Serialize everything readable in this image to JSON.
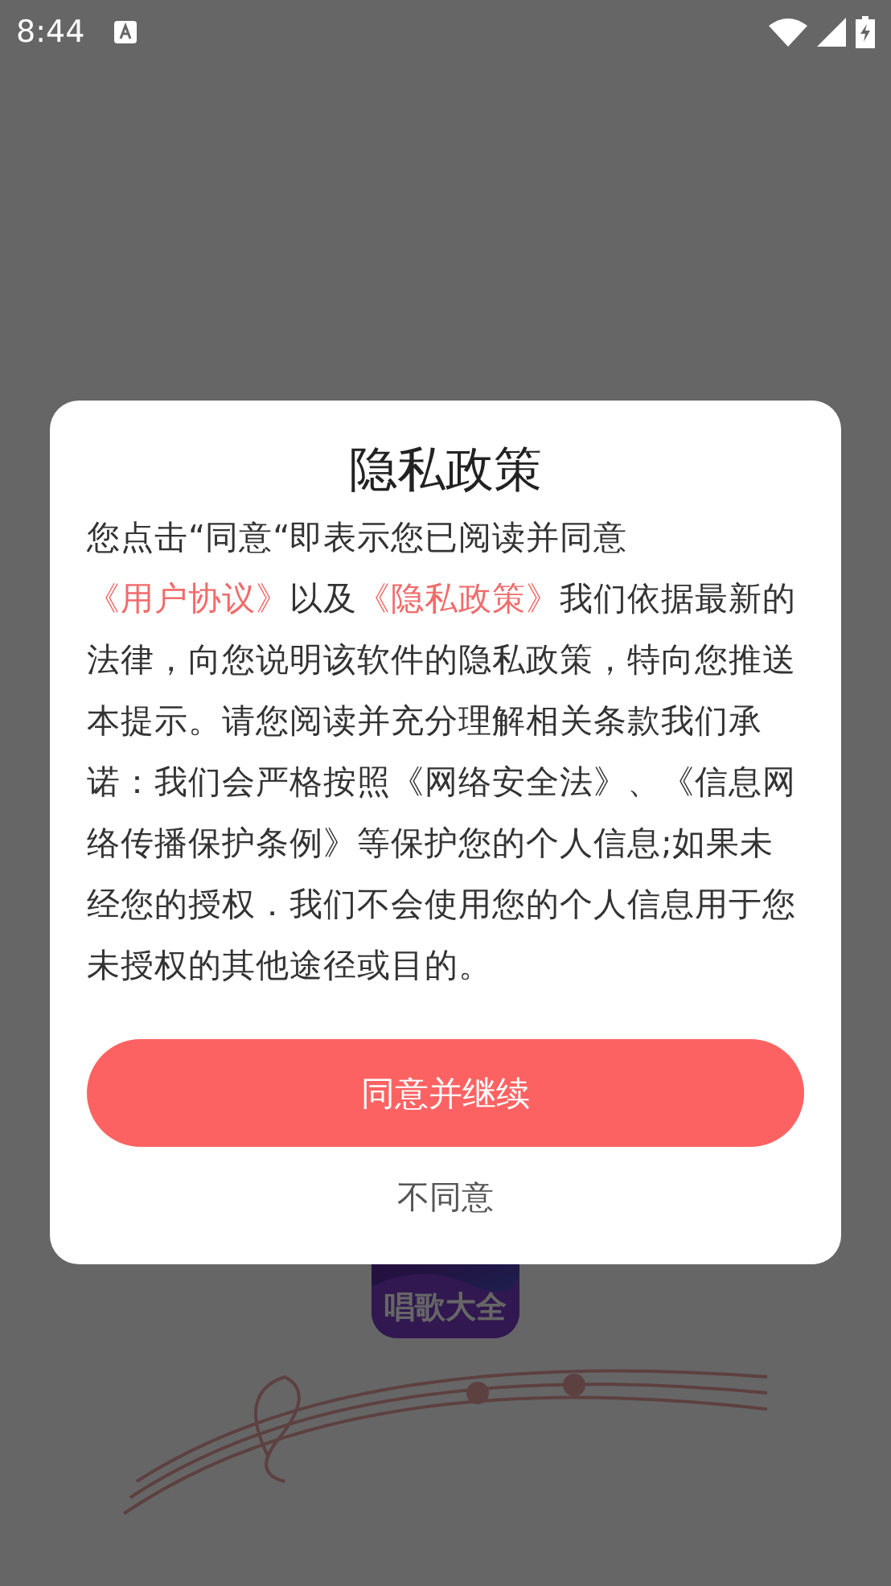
{
  "status_bar": {
    "time": "8:44"
  },
  "app_icon": {
    "label": "唱歌大全"
  },
  "dialog": {
    "title": "隐私政策",
    "body": [
      {
        "kind": "text",
        "text": "您点击“同意“即表示您已阅读并同意"
      },
      {
        "kind": "link",
        "text": "《用户协议》"
      },
      {
        "kind": "text",
        "text": "以及"
      },
      {
        "kind": "link",
        "text": "《隐私政策》"
      },
      {
        "kind": "text",
        "text": "我们依据最新的法律，向您说明该软件的隐私政策，特向您推送本提示。请您阅读并充分理解相关条款我们承诺：我们会严格按照《网络安全法》、《信息网络传播保护条例》等保护您的个人信息;如果未经您的授权．我们不会使用您的个人信息用于您未授权的其他途径或目的。"
      }
    ],
    "buttons": [
      {
        "kind": "primary",
        "label": "同意并继续"
      },
      {
        "kind": "plain",
        "label": "不同意"
      }
    ]
  }
}
